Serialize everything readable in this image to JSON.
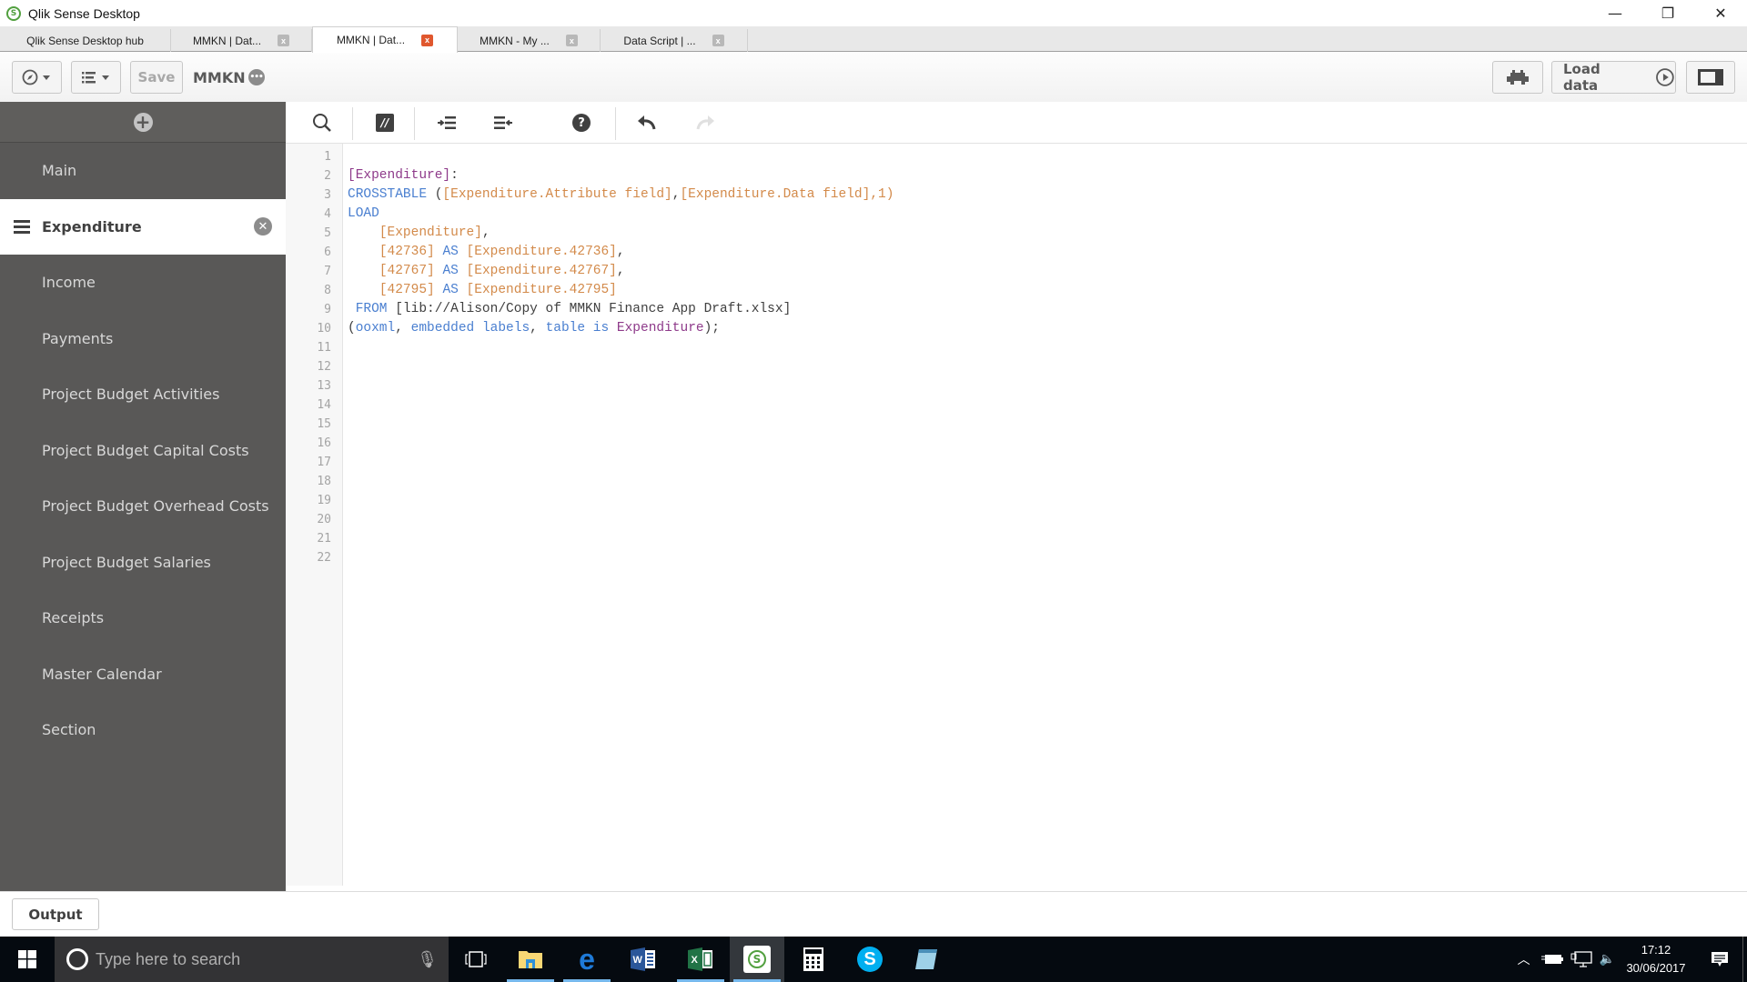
{
  "window": {
    "title": "Qlik Sense Desktop",
    "controls": {
      "minimize": "—",
      "restore": "❐",
      "close": "✕"
    }
  },
  "tabs": [
    {
      "label": "Qlik Sense Desktop hub",
      "closable": false,
      "active": false
    },
    {
      "label": "MMKN | Dat...",
      "closable": true,
      "active": false
    },
    {
      "label": "MMKN | Dat...",
      "closable": true,
      "active": true
    },
    {
      "label": "MMKN - My ...",
      "closable": true,
      "active": false
    },
    {
      "label": "Data Script | ...",
      "closable": true,
      "active": false
    }
  ],
  "tab_close_glyph": "x",
  "toolbar": {
    "navigation_icon": "compass-icon",
    "menu_icon": "list-icon",
    "save_label": "Save",
    "app_name": "MMKN",
    "more_glyph": "•••",
    "debug_icon": "debug-bug-icon",
    "load_data_label": "Load data",
    "panel_toggle_icon": "panel-toggle-icon"
  },
  "sidebar": {
    "add_glyph": "+",
    "items": [
      {
        "label": "Main",
        "active": false
      },
      {
        "label": "Expenditure",
        "active": true
      },
      {
        "label": "Income",
        "active": false
      },
      {
        "label": "Payments",
        "active": false
      },
      {
        "label": "Project Budget Activities",
        "active": false
      },
      {
        "label": "Project Budget Capital Costs",
        "active": false
      },
      {
        "label": "Project Budget Overhead Costs",
        "active": false
      },
      {
        "label": "Project Budget Salaries",
        "active": false
      },
      {
        "label": "Receipts",
        "active": false
      },
      {
        "label": "Master Calendar",
        "active": false
      },
      {
        "label": "Section",
        "active": false
      }
    ],
    "delete_glyph": "✕"
  },
  "editor_toolbar": {
    "search": "search-icon",
    "comment": "comment-toggle-icon",
    "indent": "indent-icon",
    "outdent": "outdent-icon",
    "help": "help-icon",
    "undo": "undo-icon",
    "redo": "redo-icon",
    "comment_glyph": "//",
    "help_glyph": "?"
  },
  "editor": {
    "line_count": 22,
    "lines": [
      [],
      [
        {
          "t": "[Expenditure]",
          "c": "tbl"
        },
        {
          "t": ":",
          "c": "txt"
        }
      ],
      [
        {
          "t": "CROSSTABLE",
          "c": "kw"
        },
        {
          "t": " (",
          "c": "txt"
        },
        {
          "t": "[Expenditure.Attribute field]",
          "c": "fld"
        },
        {
          "t": ",",
          "c": "txt"
        },
        {
          "t": "[Expenditure.Data field]",
          "c": "fld"
        },
        {
          "t": ",1)",
          "c": "fld"
        }
      ],
      [
        {
          "t": "LOAD",
          "c": "kw"
        }
      ],
      [
        {
          "t": "    ",
          "c": "txt"
        },
        {
          "t": "[Expenditure]",
          "c": "fld"
        },
        {
          "t": ",",
          "c": "txt"
        }
      ],
      [
        {
          "t": "    ",
          "c": "txt"
        },
        {
          "t": "[42736]",
          "c": "fld"
        },
        {
          "t": " ",
          "c": "txt"
        },
        {
          "t": "AS",
          "c": "kw"
        },
        {
          "t": " ",
          "c": "txt"
        },
        {
          "t": "[Expenditure.42736]",
          "c": "fld"
        },
        {
          "t": ",",
          "c": "txt"
        }
      ],
      [
        {
          "t": "    ",
          "c": "txt"
        },
        {
          "t": "[42767]",
          "c": "fld"
        },
        {
          "t": " ",
          "c": "txt"
        },
        {
          "t": "AS",
          "c": "kw"
        },
        {
          "t": " ",
          "c": "txt"
        },
        {
          "t": "[Expenditure.42767]",
          "c": "fld"
        },
        {
          "t": ",",
          "c": "txt"
        }
      ],
      [
        {
          "t": "    ",
          "c": "txt"
        },
        {
          "t": "[42795]",
          "c": "fld"
        },
        {
          "t": " ",
          "c": "txt"
        },
        {
          "t": "AS",
          "c": "kw"
        },
        {
          "t": " ",
          "c": "txt"
        },
        {
          "t": "[Expenditure.42795]",
          "c": "fld"
        }
      ],
      [
        {
          "t": " ",
          "c": "txt"
        },
        {
          "t": "FROM",
          "c": "kw"
        },
        {
          "t": " [lib://Alison/Copy of MMKN Finance App Draft.xlsx]",
          "c": "txt"
        }
      ],
      [
        {
          "t": "(",
          "c": "txt"
        },
        {
          "t": "ooxml",
          "c": "kw"
        },
        {
          "t": ", ",
          "c": "txt"
        },
        {
          "t": "embedded labels",
          "c": "kw"
        },
        {
          "t": ", ",
          "c": "txt"
        },
        {
          "t": "table is",
          "c": "kw"
        },
        {
          "t": " ",
          "c": "txt"
        },
        {
          "t": "Expenditure",
          "c": "tbl"
        },
        {
          "t": ");",
          "c": "txt"
        }
      ]
    ]
  },
  "output": {
    "label": "Output"
  },
  "taskbar": {
    "search_placeholder": "Type here to search",
    "apps": [
      {
        "name": "task-view",
        "running": false
      },
      {
        "name": "file-explorer",
        "running": true
      },
      {
        "name": "edge",
        "running": true
      },
      {
        "name": "word",
        "running": false
      },
      {
        "name": "excel",
        "running": true
      },
      {
        "name": "qlik-sense",
        "running": true,
        "focused": true
      },
      {
        "name": "calculator",
        "running": false
      },
      {
        "name": "skype",
        "running": false
      },
      {
        "name": "notepad",
        "running": false
      }
    ],
    "time": "17:12",
    "date": "30/06/2017"
  },
  "colors": {
    "sidebar_bg": "#595857",
    "keyword": "#4a7fd0",
    "field": "#d38a4a",
    "table": "#8e3a8a",
    "active_tab_close": "#e0572e",
    "qlik_green": "#52a03f"
  }
}
